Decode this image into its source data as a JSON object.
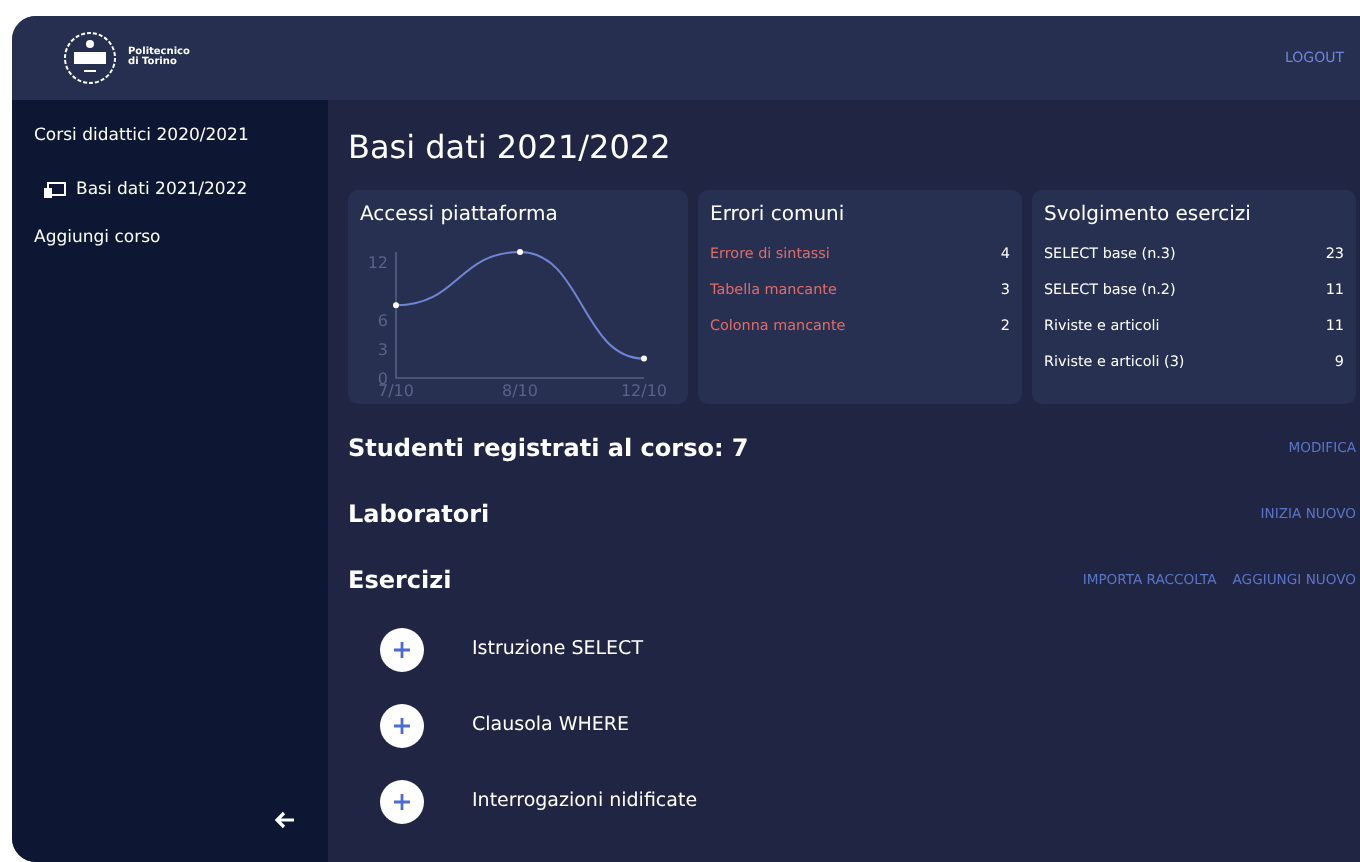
{
  "header": {
    "logo_lines": [
      "Politecnico",
      "di Torino"
    ],
    "logout": "LOGOUT"
  },
  "sidebar": {
    "section": "Corsi didattici 2020/2021",
    "items": [
      {
        "label": "Basi dati 2021/2022",
        "kind": "course"
      },
      {
        "label": "Aggiungi corso",
        "kind": "action"
      }
    ]
  },
  "page_title": "Basi dati 2021/2022",
  "cards": [
    {
      "title": "Accessi piattaforma",
      "kind": "chart",
      "chart_data": {
        "type": "line",
        "categories": [
          "7/10",
          "8/10",
          "12/10"
        ],
        "series": [
          {
            "color": "#6f86d6",
            "marker": "circle",
            "values": [
              7.5,
              13,
              2
            ]
          }
        ],
        "ylim": [
          0,
          13
        ],
        "yticks": [
          0,
          3,
          6,
          12
        ]
      }
    },
    {
      "title": "Errori comuni",
      "kind": "errors",
      "rows": [
        {
          "label": "Errore di sintassi",
          "count": "4"
        },
        {
          "label": "Tabella mancante",
          "count": "3"
        },
        {
          "label": "Colonna mancante",
          "count": "2"
        }
      ]
    },
    {
      "title": "Svolgimento esercizi",
      "kind": "list",
      "rows": [
        {
          "label": "SELECT base (n.3)",
          "count": "23"
        },
        {
          "label": "SELECT base (n.2)",
          "count": "11"
        },
        {
          "label": "Riviste e articoli",
          "count": "11"
        },
        {
          "label": "Riviste e articoli (3)",
          "count": "9"
        }
      ]
    }
  ],
  "sections": [
    {
      "title": "Studenti registrati al corso: 7",
      "actions": [
        "MODIFICA"
      ]
    },
    {
      "title": "Laboratori",
      "actions": [
        "INIZIA NUOVO"
      ]
    },
    {
      "title": "Esercizi",
      "actions": [
        "IMPORTA RACCOLTA",
        "AGGIUNGI NUOVO"
      ]
    }
  ],
  "exercises": [
    {
      "label": "Istruzione SELECT"
    },
    {
      "label": "Clausola WHERE"
    },
    {
      "label": "Interrogazioni nidificate"
    }
  ]
}
